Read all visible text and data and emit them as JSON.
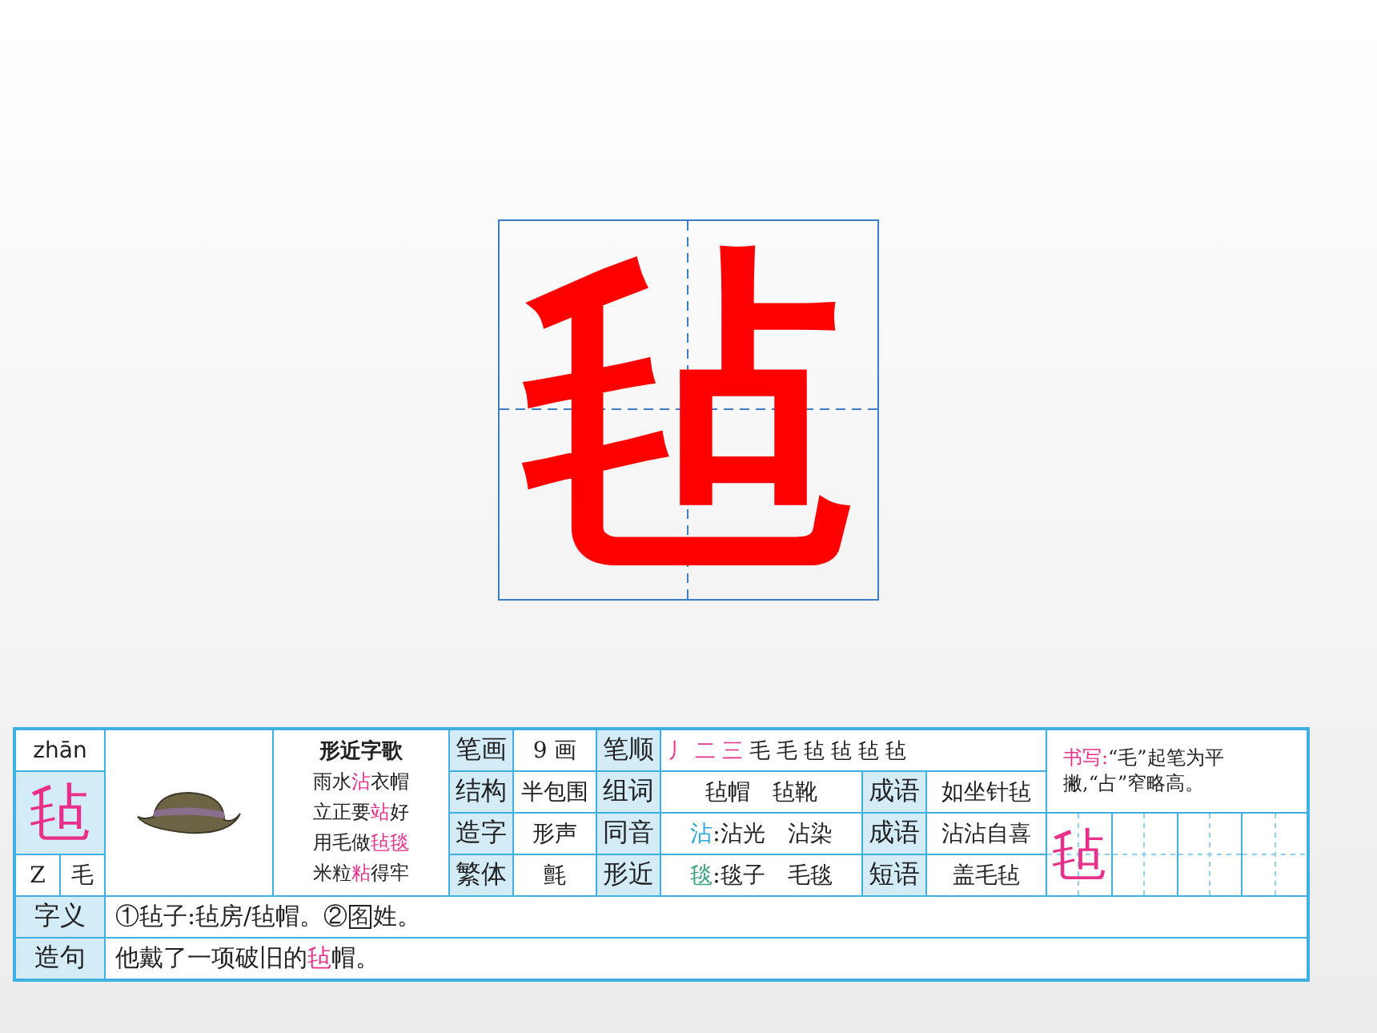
{
  "big_character": "毡",
  "card": {
    "pinyin": "zhān",
    "character": "毡",
    "index_letter": "Z",
    "radical": "毛",
    "song": {
      "title": "形近字歌",
      "lines": [
        [
          {
            "text": "雨水"
          },
          {
            "text": "沾",
            "highlight": true
          },
          {
            "text": "衣帽"
          }
        ],
        [
          {
            "text": "立正要"
          },
          {
            "text": "站",
            "highlight": true
          },
          {
            "text": "好"
          }
        ],
        [
          {
            "text": "用毛做"
          },
          {
            "text": "毡毯",
            "highlight": true
          }
        ],
        [
          {
            "text": "米粒"
          },
          {
            "text": "粘",
            "highlight": true
          },
          {
            "text": "得牢"
          }
        ]
      ]
    },
    "stroke_count": {
      "label": "笔画",
      "value": "9 画"
    },
    "stroke_order": {
      "label": "笔顺",
      "strokes": [
        "丿",
        "二",
        "三",
        "毛",
        "毛",
        "毡",
        "毡",
        "毡",
        "毡"
      ]
    },
    "writing_tip": {
      "label": "书写:",
      "text": "“毛”起笔为平撇,“占”窄略高。"
    },
    "structure": {
      "label": "结构",
      "value": "半包围"
    },
    "words": {
      "label": "组词",
      "value": "毡帽　毡靴"
    },
    "idiom_1": {
      "label": "成语",
      "value": "如坐针毡"
    },
    "formation": {
      "label": "造字",
      "value": "形声"
    },
    "homophone": {
      "label": "同音",
      "key": "沾",
      "value": ":沾光　沾染"
    },
    "idiom_2": {
      "label": "成语",
      "value": "沾沾自喜"
    },
    "practice": {
      "character": "毡"
    },
    "traditional": {
      "label": "繁体",
      "value": "氈"
    },
    "similar": {
      "label": "形近",
      "key": "毯",
      "value": ":毯子　毛毯"
    },
    "phrase": {
      "label": "短语",
      "value": "盖毛毡"
    },
    "meaning": {
      "label": "字义",
      "parts": [
        {
          "text": "①毡子:毡房/毡帽。②"
        },
        {
          "text": "名",
          "boxed": true
        },
        {
          "text": "姓。"
        }
      ]
    },
    "sentence": {
      "label": "造句",
      "parts": [
        {
          "text": "他戴了一项破旧的"
        },
        {
          "text": "毡",
          "highlight": true
        },
        {
          "text": "帽。"
        }
      ]
    }
  }
}
